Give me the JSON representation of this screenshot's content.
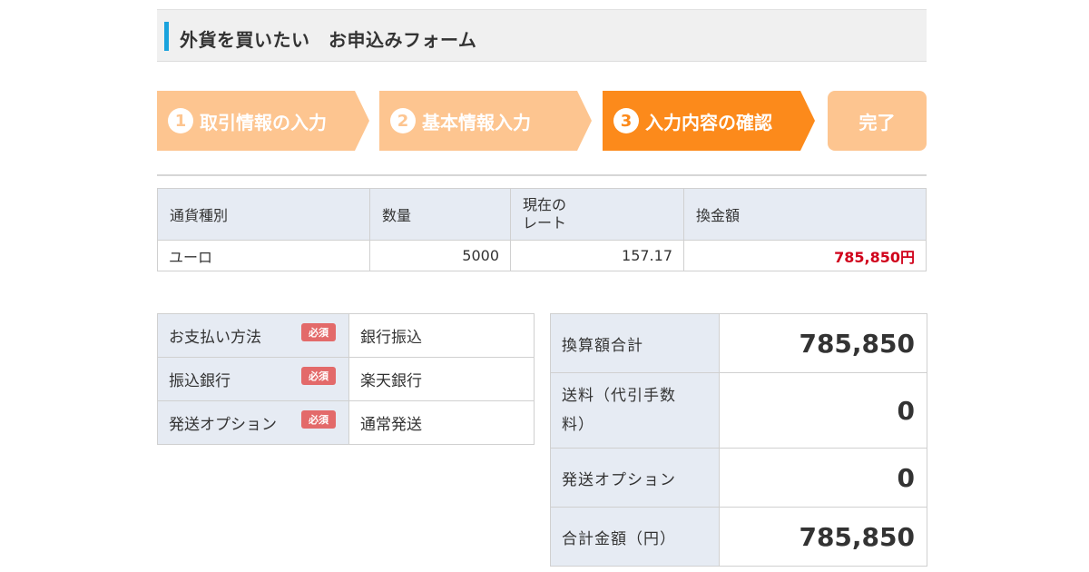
{
  "header": {
    "title": "外貨を買いたい　お申込みフォーム"
  },
  "steps": [
    {
      "num": "1",
      "label": "取引情報の入力"
    },
    {
      "num": "2",
      "label": "基本情報入力"
    },
    {
      "num": "3",
      "label": "入力内容の確認"
    },
    {
      "label": "完了"
    }
  ],
  "currency_table": {
    "headers": [
      "通貨種別",
      "数量",
      "現在の\nレート",
      "換金額"
    ],
    "row": {
      "currency": "ユーロ",
      "quantity": "5000",
      "rate": "157.17",
      "amount": "785,850円"
    }
  },
  "payment": [
    {
      "label": "お支払い方法",
      "badge": "必須",
      "value": "銀行振込"
    },
    {
      "label": "振込銀行",
      "badge": "必須",
      "value": "楽天銀行"
    },
    {
      "label": "発送オプション",
      "badge": "必須",
      "value": "通常発送"
    }
  ],
  "summary": [
    {
      "label": "換算額合計",
      "value": "785,850"
    },
    {
      "label": "送料（代引手数料）",
      "value": "0"
    },
    {
      "label": "発送オプション",
      "value": "0"
    },
    {
      "label": "合計金額（円）",
      "value": "785,850"
    }
  ],
  "colors": {
    "accent_bar": "#1aa3dd",
    "step_active": "#fc8a1b",
    "step_inactive": "#fdc590",
    "amount_red": "#d0021b",
    "required_badge": "#e36a6a"
  }
}
